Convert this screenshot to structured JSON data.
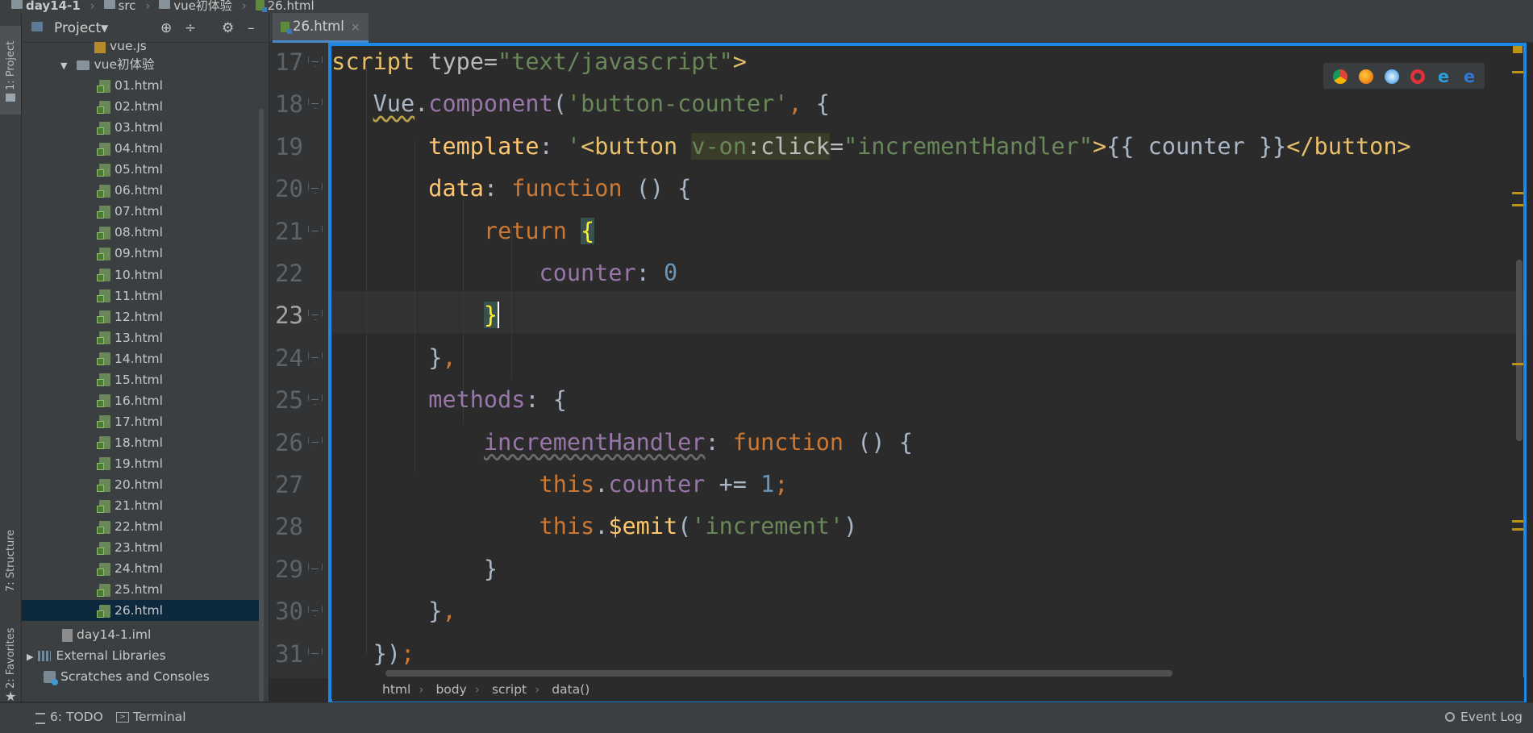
{
  "breadcrumb_top": [
    "day14-1",
    "src",
    "vue初体验",
    "26.html"
  ],
  "toolwindow_strip": {
    "project_label": "1: Project",
    "structure_label": "7: Structure",
    "favorites_label": "2: Favorites"
  },
  "project_panel": {
    "title": "Project",
    "items": [
      {
        "label": "vue.js",
        "type": "js"
      },
      {
        "label": "vue初体验",
        "type": "folder"
      },
      {
        "label": "01.html",
        "type": "html"
      },
      {
        "label": "02.html",
        "type": "html"
      },
      {
        "label": "03.html",
        "type": "html"
      },
      {
        "label": "04.html",
        "type": "html"
      },
      {
        "label": "05.html",
        "type": "html"
      },
      {
        "label": "06.html",
        "type": "html"
      },
      {
        "label": "07.html",
        "type": "html"
      },
      {
        "label": "08.html",
        "type": "html"
      },
      {
        "label": "09.html",
        "type": "html"
      },
      {
        "label": "10.html",
        "type": "html"
      },
      {
        "label": "11.html",
        "type": "html"
      },
      {
        "label": "12.html",
        "type": "html"
      },
      {
        "label": "13.html",
        "type": "html"
      },
      {
        "label": "14.html",
        "type": "html"
      },
      {
        "label": "15.html",
        "type": "html"
      },
      {
        "label": "16.html",
        "type": "html"
      },
      {
        "label": "17.html",
        "type": "html"
      },
      {
        "label": "18.html",
        "type": "html"
      },
      {
        "label": "19.html",
        "type": "html"
      },
      {
        "label": "20.html",
        "type": "html"
      },
      {
        "label": "21.html",
        "type": "html"
      },
      {
        "label": "22.html",
        "type": "html"
      },
      {
        "label": "23.html",
        "type": "html"
      },
      {
        "label": "24.html",
        "type": "html"
      },
      {
        "label": "25.html",
        "type": "html"
      },
      {
        "label": "26.html",
        "type": "html",
        "selected": true
      },
      {
        "label": "day14-1.iml",
        "type": "iml"
      },
      {
        "label": "External Libraries",
        "type": "lib"
      },
      {
        "label": "Scratches and Consoles",
        "type": "scratch"
      }
    ]
  },
  "editor": {
    "tab_label": "26.html",
    "current_line": 23,
    "line_numbers": [
      "17",
      "18",
      "19",
      "20",
      "21",
      "22",
      "23",
      "24",
      "25",
      "26",
      "27",
      "28",
      "29",
      "30",
      "31"
    ],
    "lines": [
      "<script type=\"text/javascript\">",
      "    Vue.component('button-counter', {",
      "        template: '<button v-on:click=\"incrementHandler\">{{ counter }}</button>",
      "        data: function () {",
      "            return {",
      "                counter: 0",
      "            }",
      "        },",
      "        methods: {",
      "            incrementHandler: function () {",
      "                this.counter += 1;",
      "                this.$emit('increment')",
      "            }",
      "        },",
      "    });"
    ]
  },
  "browser_icons": [
    "chrome-icon",
    "firefox-icon",
    "safari-icon",
    "opera-icon",
    "ie-icon",
    "edge-icon"
  ],
  "code_breadcrumb": [
    "html",
    "body",
    "script",
    "data()"
  ],
  "status_bar": {
    "todo_label": "6: TODO",
    "terminal_label": "Terminal",
    "event_log_label": "Event Log"
  },
  "colors": {
    "accent": "#1e88e5",
    "keyword": "#cc7832",
    "string": "#6a8759",
    "property": "#9876aa",
    "number": "#6897bb",
    "function": "#ffc66d"
  }
}
